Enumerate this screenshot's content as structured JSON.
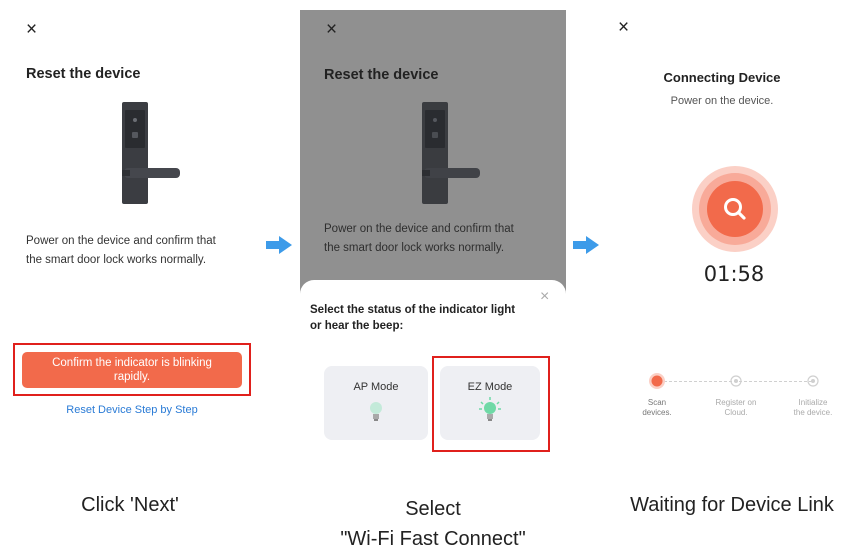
{
  "panel1": {
    "close": "×",
    "title": "Reset the device",
    "description_line1": "Power on the device and confirm that",
    "description_line2": "the smart door lock works normally.",
    "confirm_line1": "Confirm the indicator is blinking",
    "confirm_line2": "rapidly.",
    "reset_link": "Reset Device Step by Step"
  },
  "panel2": {
    "close": "×",
    "title": "Reset the device",
    "description_line1": "Power on the device and confirm that",
    "description_line2": "the smart door lock works normally.",
    "sheet_close": "×",
    "sheet_title_line1": "Select the status of the indicator light",
    "sheet_title_line2": "or hear the beep:",
    "modes": [
      {
        "label": "AP Mode"
      },
      {
        "label": "EZ Mode"
      }
    ]
  },
  "panel3": {
    "close": "×",
    "title": "Connecting Device",
    "subtitle": "Power on the device.",
    "timer": "01:58",
    "steps": [
      {
        "line1": "Scan",
        "line2": "devices."
      },
      {
        "line1": "Register on",
        "line2": "Cloud."
      },
      {
        "line1": "Initialize",
        "line2": "the device."
      }
    ]
  },
  "captions": {
    "left": "Click 'Next'",
    "middle_line1": "Select",
    "middle_line2": "\"Wi-Fi Fast Connect\"",
    "right": "Waiting for Device Link"
  },
  "colors": {
    "accent": "#f26a4b",
    "highlight": "#e0201c",
    "link": "#2a7bd6",
    "arrow": "#3d9be9",
    "dim_overlay": "#909090",
    "card": "#eeeff3"
  },
  "icons": {
    "close": "close-icon",
    "door_lock": "door-lock-icon",
    "arrow": "arrow-right-icon",
    "bulb": "light-bulb-icon",
    "search": "search-icon"
  }
}
